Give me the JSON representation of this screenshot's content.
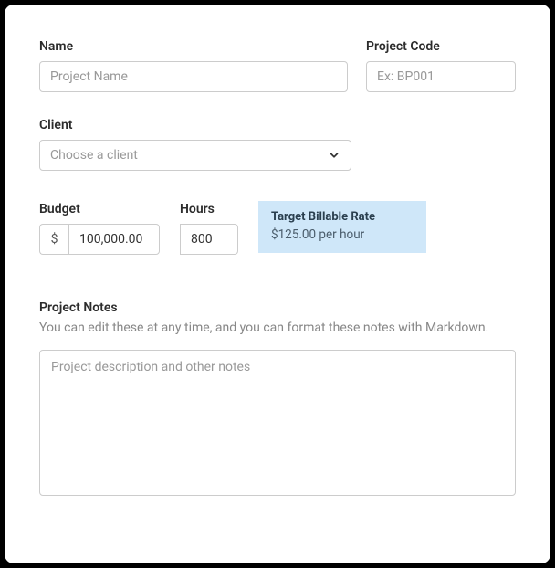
{
  "name": {
    "label": "Name",
    "placeholder": "Project Name",
    "value": ""
  },
  "code": {
    "label": "Project Code",
    "placeholder": "Ex: BP001",
    "value": ""
  },
  "client": {
    "label": "Client",
    "placeholder": "Choose a client",
    "value": ""
  },
  "budget": {
    "label": "Budget",
    "currency": "$",
    "value": "100,000.00"
  },
  "hours": {
    "label": "Hours",
    "value": "800"
  },
  "rate": {
    "title": "Target Billable Rate",
    "value": "$125.00 per hour"
  },
  "notes": {
    "label": "Project Notes",
    "help": "You can edit these at any time, and you can format these notes with Markdown.",
    "placeholder": "Project description and other notes",
    "value": ""
  }
}
